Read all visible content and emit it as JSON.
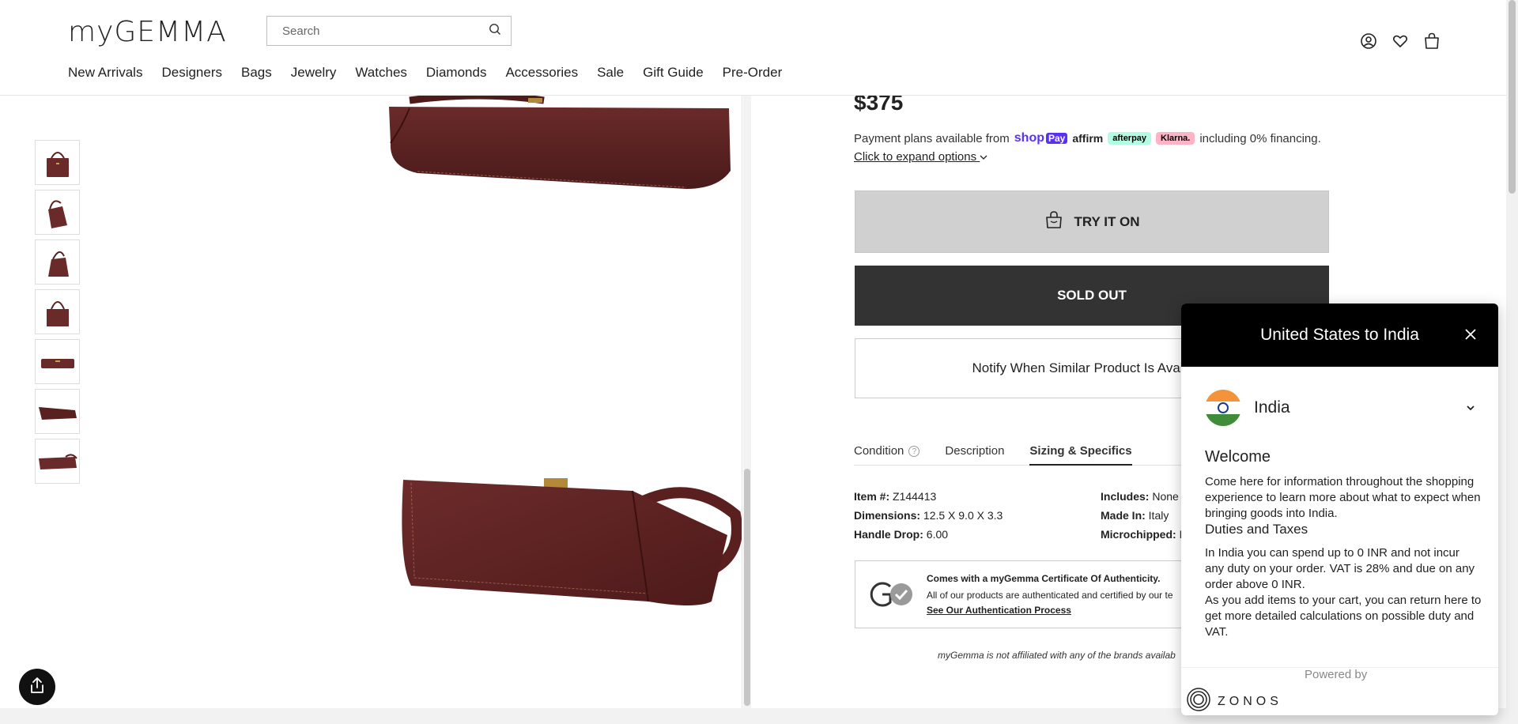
{
  "header": {
    "logo": "myGEMMA",
    "search_placeholder": "Search",
    "nav": [
      "New Arrivals",
      "Designers",
      "Bags",
      "Jewelry",
      "Watches",
      "Diamonds",
      "Accessories",
      "Sale",
      "Gift Guide",
      "Pre-Order"
    ],
    "icons": [
      "account-icon",
      "wishlist-heart-icon",
      "shopping-bag-icon"
    ]
  },
  "gallery": {
    "thumbnail_count": 7,
    "bag_color": "#6b2a2a"
  },
  "product": {
    "price": "$375",
    "payment_prefix": "Payment plans available from",
    "shop_pay": "shop",
    "shop_pay_suffix": "Pay",
    "affirm": "affirm",
    "afterpay": "afterpay",
    "klarna": "Klarna.",
    "payment_suffix": "including 0% financing.",
    "expand_options": "Click to expand options",
    "try_it_on": "TRY IT ON",
    "sold_out": "SOLD OUT",
    "notify": "Notify When Similar Product Is Available"
  },
  "tabs": [
    {
      "label": "Condition",
      "active": false
    },
    {
      "label": "Description",
      "active": false
    },
    {
      "label": "Sizing & Specifics",
      "active": true
    }
  ],
  "specs": {
    "left": [
      {
        "label": "Item #:",
        "value": "Z144413"
      },
      {
        "label": "Dimensions:",
        "value": "12.5 X 9.0 X 3.3"
      },
      {
        "label": "Handle Drop:",
        "value": "6.00"
      }
    ],
    "right": [
      {
        "label": "Includes:",
        "value": "None"
      },
      {
        "label": "Made In:",
        "value": "Italy"
      },
      {
        "label": "Microchipped:",
        "value": "N"
      }
    ]
  },
  "authenticity": {
    "title": "Comes with a myGemma Certificate Of Authenticity.",
    "text": "All of our products are authenticated and certified by our te",
    "link": "See Our Authentication Process"
  },
  "disclaimer": "myGemma is not affiliated with any of the brands availab",
  "modal": {
    "title": "United States to India",
    "country": "India",
    "welcome": "Welcome",
    "intro": "Come here for information throughout the shopping experience to learn more about what to expect when bringing goods into India.",
    "duties_heading": "Duties and Taxes",
    "duties_text": "In India you can spend up to 0 INR and not incur any duty on your order. VAT is 28% and due on any order above 0 INR.",
    "cart_text": "As you add items to your cart, you can return here to get more detailed calculations on possible duty and VAT.",
    "powered_by": "Powered by",
    "brand": "ZONOS"
  }
}
